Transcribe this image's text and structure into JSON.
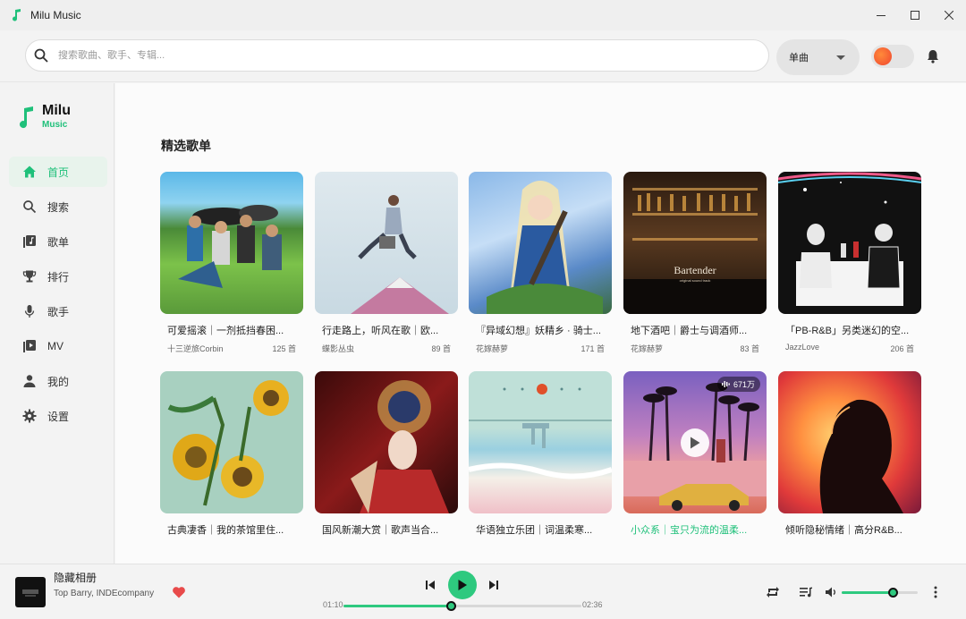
{
  "window": {
    "title": "Milu Music",
    "controls": [
      "minimize-icon",
      "maximize-icon",
      "close-icon"
    ]
  },
  "header": {
    "search_placeholder": "搜索歌曲、歌手、专辑...",
    "search_type": "单曲"
  },
  "brand": {
    "name": "Milu",
    "sub": "Music",
    "accent": "#1fc07a"
  },
  "sidebar": {
    "items": [
      {
        "label": "首页",
        "icon": "home-icon",
        "active": true
      },
      {
        "label": "搜索",
        "icon": "search-icon",
        "active": false
      },
      {
        "label": "歌单",
        "icon": "playlist-icon",
        "active": false
      },
      {
        "label": "排行",
        "icon": "trophy-icon",
        "active": false
      },
      {
        "label": "歌手",
        "icon": "microphone-icon",
        "active": false
      },
      {
        "label": "MV",
        "icon": "video-icon",
        "active": false
      },
      {
        "label": "我的",
        "icon": "person-icon",
        "active": false
      },
      {
        "label": "设置",
        "icon": "gear-icon",
        "active": false
      }
    ]
  },
  "main": {
    "section_title": "精选歌单",
    "playlists": [
      {
        "title": "可爱摇滚｜一剂抵挡春困...",
        "creator": "十三逆旅Corbin",
        "count": "125 首"
      },
      {
        "title": "行走路上，听风在歌｜欧...",
        "creator": "蝶影丛虫",
        "count": "89 首"
      },
      {
        "title": "『异域幻想』妖精乡 · 骑士...",
        "creator": "花嫁赫萝",
        "count": "171 首"
      },
      {
        "title": "地下酒吧｜爵士与调酒师...",
        "creator": "花嫁赫萝",
        "count": "83 首"
      },
      {
        "title": "「PB-R&B」另类迷幻的空...",
        "creator": "JazzLove",
        "count": "206 首"
      },
      {
        "title": "古典凄香｜我的茶馆里住...",
        "creator": "",
        "count": ""
      },
      {
        "title": "国风新潮大赏｜歌声当合...",
        "creator": "",
        "count": ""
      },
      {
        "title": "华语独立乐团｜词温柔寒...",
        "creator": "",
        "count": ""
      },
      {
        "title": "小众系｜宝只为流的温柔...",
        "creator": "",
        "count": "",
        "hover": true,
        "play_count": "671万"
      },
      {
        "title": "倾听隐秘情绪｜高分R&B...",
        "creator": "",
        "count": ""
      }
    ],
    "cover_texts": {
      "bartender": "Bartender",
      "bartender_sub": "original sound track"
    }
  },
  "player": {
    "title": "隐藏相册",
    "artist": "Top Barry, INDEcompany",
    "liked": true,
    "current_time": "01:10",
    "total_time": "02:36",
    "progress": 0.45,
    "volume": 0.67,
    "accent": "#2ec97f"
  }
}
